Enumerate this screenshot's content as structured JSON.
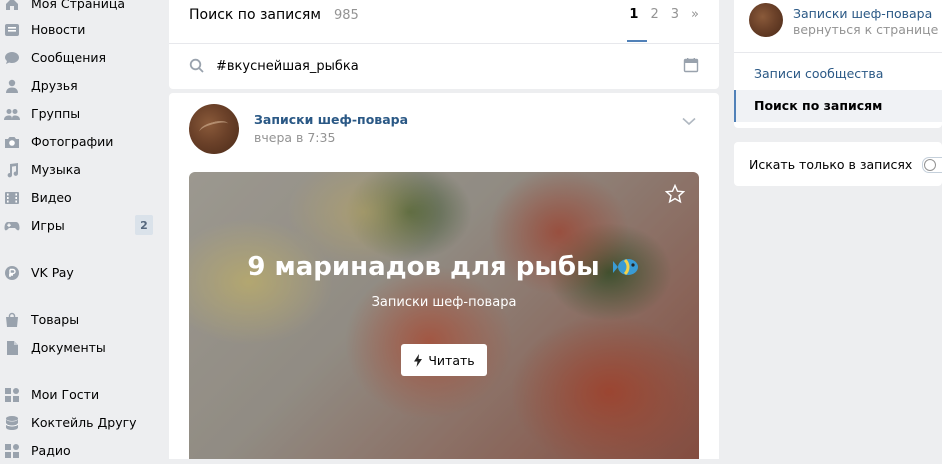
{
  "sidebar": {
    "items": [
      {
        "label": "Моя Страница",
        "icon": "home-icon"
      },
      {
        "label": "Новости",
        "icon": "news-icon"
      },
      {
        "label": "Сообщения",
        "icon": "messages-icon"
      },
      {
        "label": "Друзья",
        "icon": "friends-icon"
      },
      {
        "label": "Группы",
        "icon": "groups-icon"
      },
      {
        "label": "Фотографии",
        "icon": "camera-icon"
      },
      {
        "label": "Музыка",
        "icon": "music-icon"
      },
      {
        "label": "Видео",
        "icon": "video-icon"
      },
      {
        "label": "Игры",
        "icon": "gamepad-icon",
        "badge": "2"
      },
      {
        "label": "VK Pay",
        "icon": "vkpay-icon"
      },
      {
        "label": "Товары",
        "icon": "bag-icon"
      },
      {
        "label": "Документы",
        "icon": "document-icon"
      },
      {
        "label": "Мои Гости",
        "icon": "apps-icon"
      },
      {
        "label": "Коктейль Другу",
        "icon": "database-icon"
      },
      {
        "label": "Радио",
        "icon": "apps-icon"
      }
    ]
  },
  "search": {
    "title": "Поиск по записям",
    "count": "985",
    "pages": [
      "1",
      "2",
      "3",
      "»"
    ],
    "query": "#вкуснейшая_рыбка"
  },
  "post": {
    "author": "Записки шеф-повара",
    "time": "вчера в 7:35",
    "article": {
      "title": "9 маринадов для рыбы",
      "subtitle": "Записки шеф-повара",
      "read_label": "Читать"
    }
  },
  "right": {
    "community_name": "Записки шеф-повара",
    "back_label": "вернуться к странице",
    "menu": [
      "Записи сообщества",
      "Поиск по записям"
    ],
    "toggle_label": "Искать только в записях"
  },
  "colors": {
    "link": "#2a5885",
    "accent": "#5181b8",
    "muted": "#939393",
    "background": "#edeef0"
  }
}
